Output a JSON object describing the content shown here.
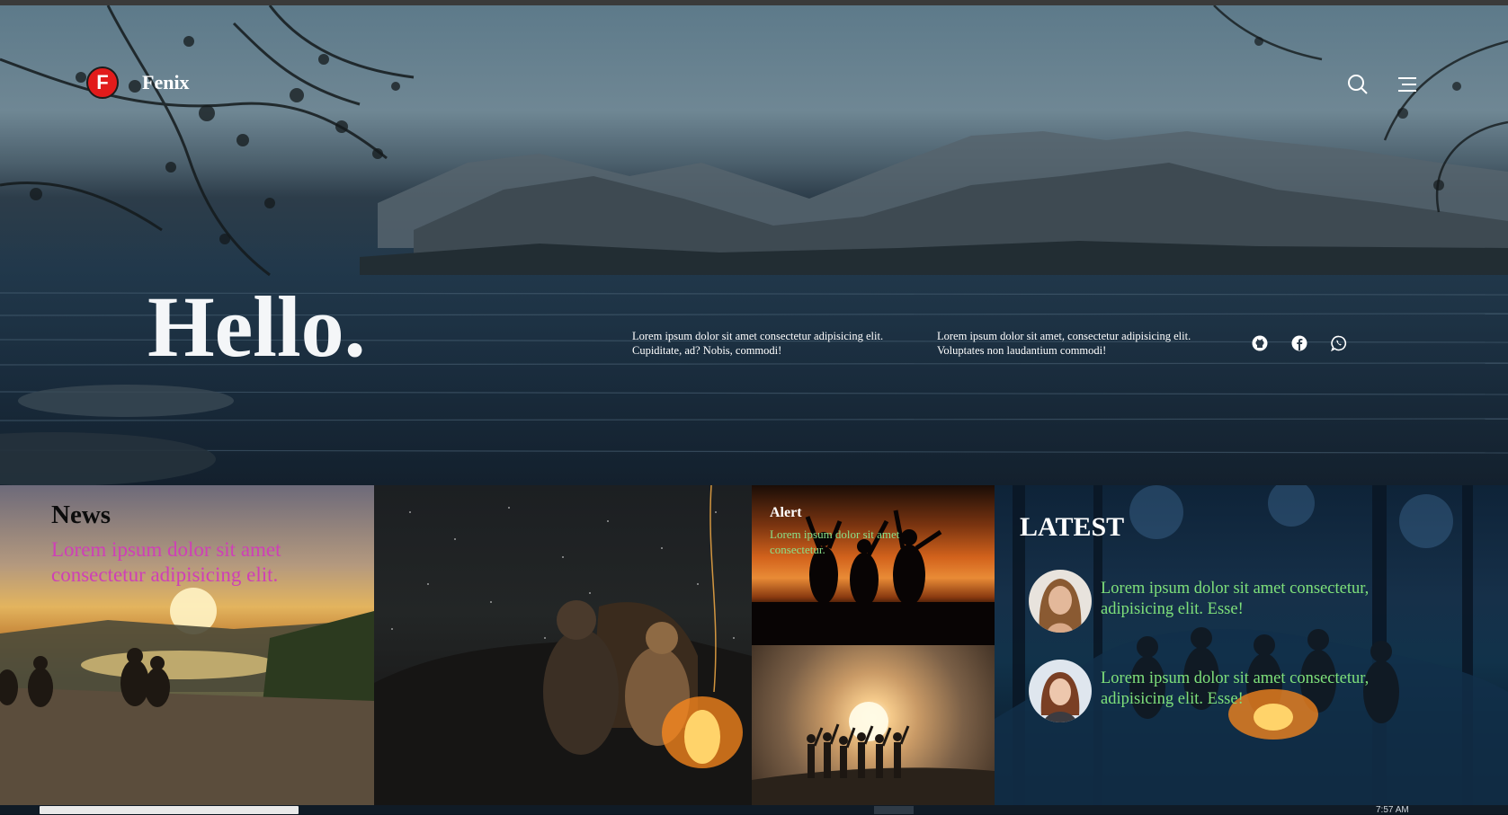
{
  "brand": {
    "logo_letter": "F",
    "name": "Fenix",
    "color": "#e21b1b"
  },
  "hero": {
    "heading": "Hello.",
    "blurb_1": "Lorem ipsum dolor sit amet consectetur adipisicing elit. Cupiditate, ad? Nobis, commodi!",
    "blurb_2": "Lorem ipsum dolor sit amet, consectetur adipisicing elit. Voluptates non laudantium commodi!"
  },
  "header_icons": [
    "search-icon",
    "menu-icon"
  ],
  "social_icons": [
    "github-icon",
    "facebook-icon",
    "whatsapp-icon"
  ],
  "news": {
    "title": "News",
    "text": "Lorem ipsum dolor sit amet consectetur adipisicing elit.",
    "text_color": "#cf3fb7"
  },
  "alert": {
    "title": "Alert",
    "text": "Lorem ipsum dolor sit amet consectetur.",
    "text_color": "#8be28a"
  },
  "latest": {
    "title": "LATEST",
    "items": [
      {
        "text": "Lorem ipsum dolor sit amet consectetur, adipisicing elit. Esse!"
      },
      {
        "text": "Lorem ipsum dolor sit amet consectetur, adipisicing elit. Esse!"
      }
    ],
    "text_color": "#7ee07a"
  },
  "taskbar": {
    "clock": "7:57 AM"
  }
}
